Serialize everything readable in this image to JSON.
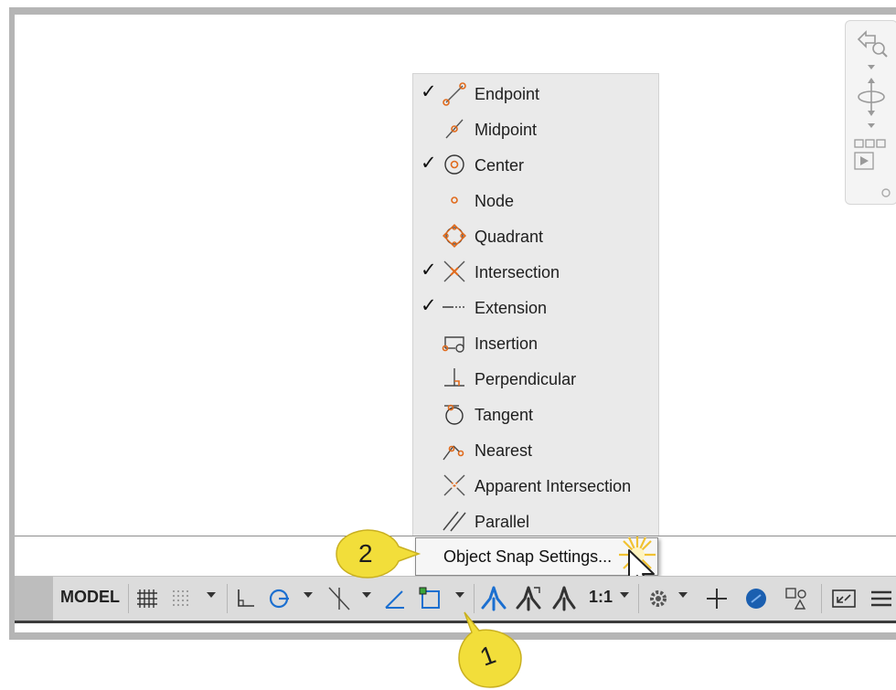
{
  "osnap_menu": {
    "items": [
      {
        "label": "Endpoint",
        "checked": true,
        "icon": "endpoint-icon"
      },
      {
        "label": "Midpoint",
        "checked": false,
        "icon": "midpoint-icon"
      },
      {
        "label": "Center",
        "checked": true,
        "icon": "center-icon"
      },
      {
        "label": "Node",
        "checked": false,
        "icon": "node-icon"
      },
      {
        "label": "Quadrant",
        "checked": false,
        "icon": "quadrant-icon"
      },
      {
        "label": "Intersection",
        "checked": true,
        "icon": "intersection-icon"
      },
      {
        "label": "Extension",
        "checked": true,
        "icon": "extension-icon"
      },
      {
        "label": "Insertion",
        "checked": false,
        "icon": "insertion-icon"
      },
      {
        "label": "Perpendicular",
        "checked": false,
        "icon": "perpendicular-icon"
      },
      {
        "label": "Tangent",
        "checked": false,
        "icon": "tangent-icon"
      },
      {
        "label": "Nearest",
        "checked": false,
        "icon": "nearest-icon"
      },
      {
        "label": "Apparent Intersection",
        "checked": false,
        "icon": "apparent-intersection-icon"
      },
      {
        "label": "Parallel",
        "checked": false,
        "icon": "parallel-icon"
      }
    ],
    "check_mark": "✓",
    "settings_label": "Object Snap Settings..."
  },
  "status_bar": {
    "model_label": "MODEL",
    "annotation_scale": "1:1"
  },
  "callouts": {
    "step_1": "1",
    "step_2": "2"
  },
  "colors": {
    "osnap_accent": "#e06a1c",
    "ui_blue": "#1b6fd0",
    "callout_yellow": "#f2de3a"
  }
}
